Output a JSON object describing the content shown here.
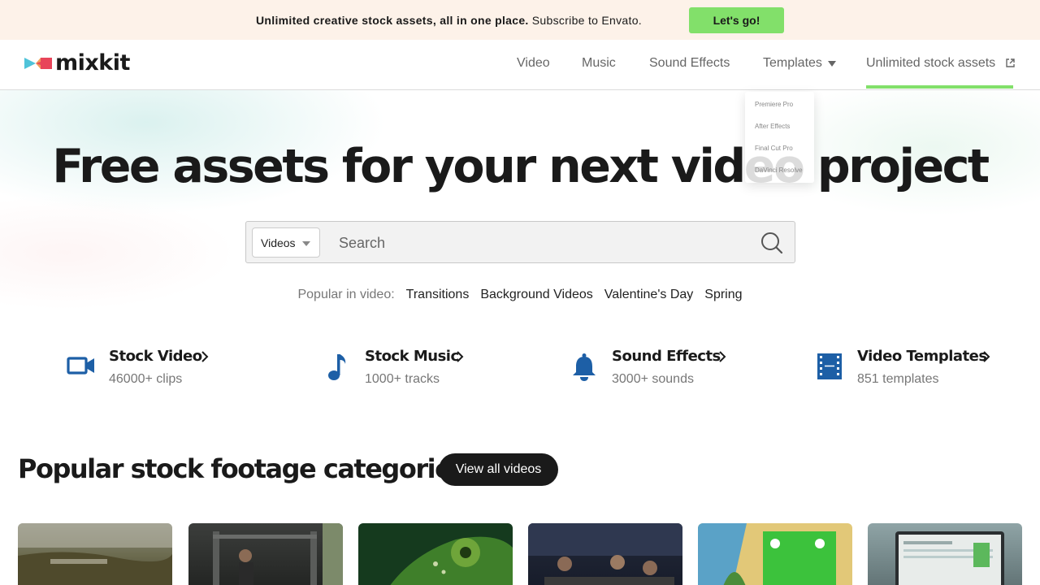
{
  "promo": {
    "bold_text": "Unlimited creative stock assets, all in one place.",
    "text": "Subscribe to Envato.",
    "button_label": "Let's go!"
  },
  "header": {
    "logo_text": "mixkit",
    "nav": [
      {
        "label": "Video"
      },
      {
        "label": "Music"
      },
      {
        "label": "Sound Effects"
      },
      {
        "label": "Templates"
      },
      {
        "label": "Unlimited stock assets"
      }
    ],
    "templates_dropdown": [
      "Premiere Pro",
      "After Effects",
      "Final Cut Pro",
      "DaVinci Resolve"
    ]
  },
  "hero": {
    "title": "Free assets for your next video project"
  },
  "search": {
    "selected_type": "Videos",
    "placeholder": "Search"
  },
  "popular": {
    "label": "Popular in video:",
    "links": [
      "Transitions",
      "Background Videos",
      "Valentine's Day",
      "Spring"
    ]
  },
  "categories": [
    {
      "title": "Stock Video",
      "subtitle": "46000+ clips",
      "icon": "video-camera-icon"
    },
    {
      "title": "Stock Music",
      "subtitle": "1000+ tracks",
      "icon": "music-note-icon"
    },
    {
      "title": "Sound Effects",
      "subtitle": "3000+ sounds",
      "icon": "bell-icon"
    },
    {
      "title": "Video Templates",
      "subtitle": "851 templates",
      "icon": "film-strip-icon"
    }
  ],
  "section": {
    "title": "Popular stock footage categories",
    "button_label": "View all videos"
  },
  "colors": {
    "accent_green": "#82e06a",
    "icon_blue": "#1d5fa6",
    "promo_bg": "#fdf2e9"
  }
}
